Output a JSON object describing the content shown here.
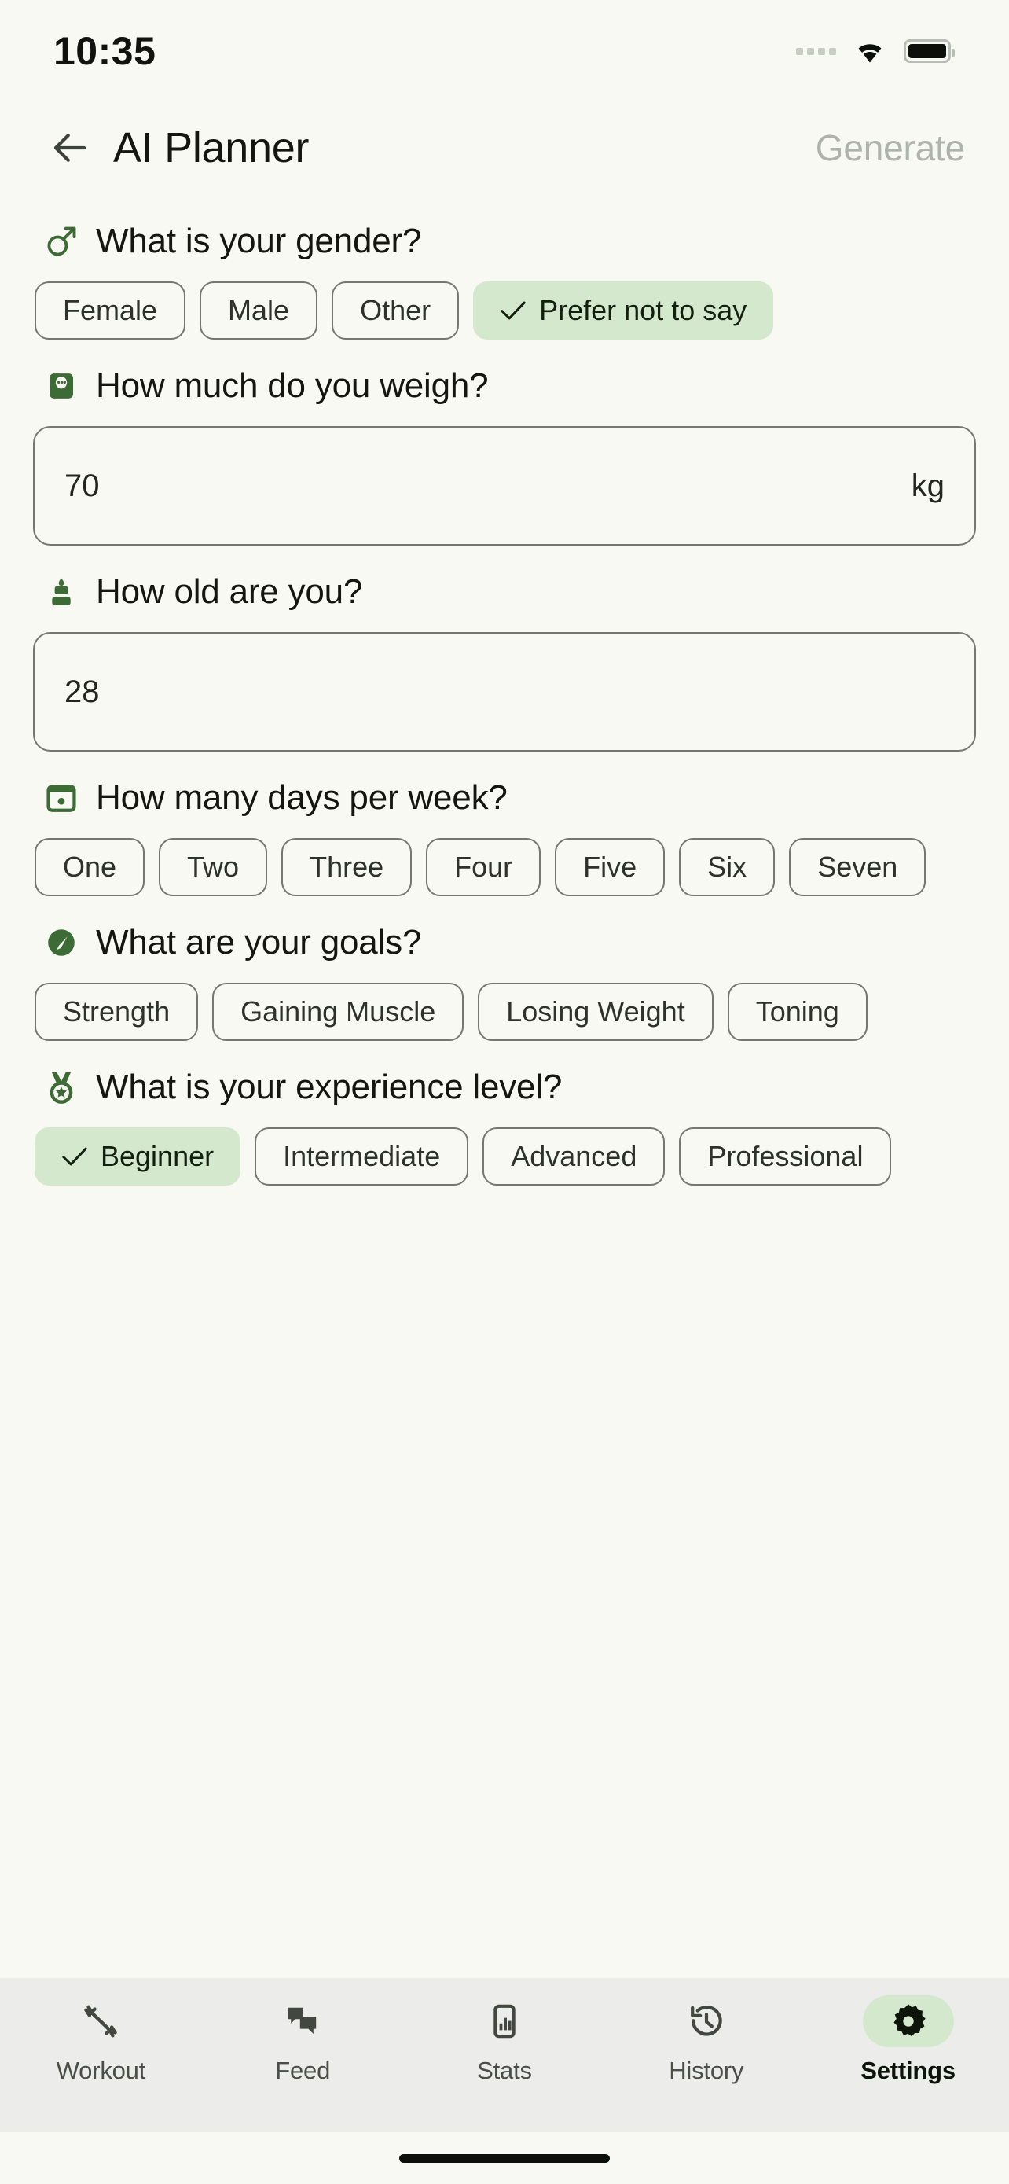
{
  "theme": {
    "page_bg": "#f8f9f3",
    "nav_bg": "#ecedea",
    "accent_green": "#3d6b35",
    "selected_chip_bg": "#d4e8ce",
    "text_primary": "#14160f",
    "border": "#75786e",
    "disabled_text": "#b0b2ac"
  },
  "status_bar": {
    "time": "10:35",
    "signal_icon": "signal-dots-icon",
    "wifi_icon": "wifi-icon",
    "battery_icon": "battery-icon"
  },
  "header": {
    "back_icon": "back-arrow-icon",
    "title": "AI Planner",
    "action_label": "Generate"
  },
  "sections": [
    {
      "key": "gender",
      "icon": "mars-gender-icon",
      "question": "What is your gender?",
      "type": "chips",
      "options": [
        "Female",
        "Male",
        "Other",
        "Prefer not to say"
      ],
      "selected": "Prefer not to say"
    },
    {
      "key": "weight",
      "icon": "scale-icon",
      "question": "How much do you weigh?",
      "type": "input",
      "value": "70",
      "suffix": "kg"
    },
    {
      "key": "age",
      "icon": "birthday-cake-icon",
      "question": "How old are you?",
      "type": "input",
      "value": "28",
      "suffix": ""
    },
    {
      "key": "days_per_week",
      "icon": "calendar-icon",
      "question": "How many days per week?",
      "type": "chips",
      "options": [
        "One",
        "Two",
        "Three",
        "Four",
        "Five",
        "Six",
        "Seven"
      ],
      "selected": null
    },
    {
      "key": "goals",
      "icon": "gauge-icon",
      "question": "What are your goals?",
      "type": "chips",
      "options": [
        "Strength",
        "Gaining Muscle",
        "Losing Weight",
        "Toning"
      ],
      "selected": null
    },
    {
      "key": "experience",
      "icon": "medal-icon",
      "question": "What is your experience level?",
      "type": "chips",
      "options": [
        "Beginner",
        "Intermediate",
        "Advanced",
        "Professional"
      ],
      "selected": "Beginner"
    }
  ],
  "bottom_nav": {
    "items": [
      {
        "label": "Workout",
        "icon": "dumbbell-icon",
        "active": false
      },
      {
        "label": "Feed",
        "icon": "chat-bubbles-icon",
        "active": false
      },
      {
        "label": "Stats",
        "icon": "phone-chart-icon",
        "active": false
      },
      {
        "label": "History",
        "icon": "clock-rewind-icon",
        "active": false
      },
      {
        "label": "Settings",
        "icon": "gear-icon",
        "active": true
      }
    ]
  }
}
